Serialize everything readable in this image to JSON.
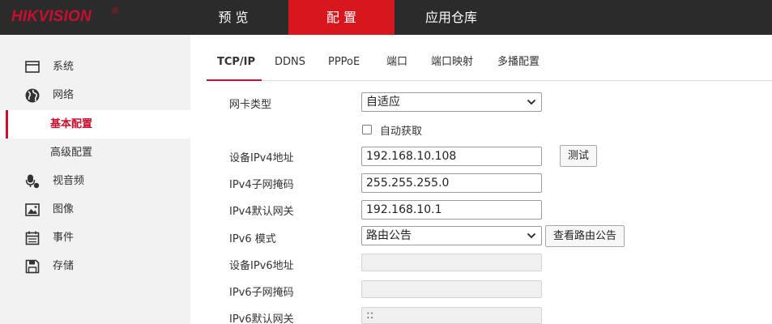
{
  "brand": {
    "logo_text": "HIKVISION",
    "reg_mark": "®",
    "accent": "#c8102e",
    "topbar_bg": "#2b2b2b",
    "active_nav_bg": "#d7161e"
  },
  "topnav": {
    "preview": "预 览",
    "config": "配 置",
    "apps": "应用仓库"
  },
  "sidebar": {
    "system": "系统",
    "network": "网络",
    "basic_config": "基本配置",
    "advanced_config": "高级配置",
    "video_audio": "视音频",
    "image": "图像",
    "event": "事件",
    "storage": "存储"
  },
  "tabs": [
    "TCP/IP",
    "DDNS",
    "PPPoE",
    "端口",
    "端口映射",
    "多播配置"
  ],
  "form": {
    "nic_type_label": "网卡类型",
    "nic_type_value": "自适应",
    "auto_obtain_label": "自动获取",
    "ipv4_addr_label": "设备IPv4地址",
    "ipv4_addr_value": "192.168.10.108",
    "test_button": "测试",
    "ipv4_mask_label": "IPv4子网掩码",
    "ipv4_mask_value": "255.255.255.0",
    "ipv4_gw_label": "IPv4默认网关",
    "ipv4_gw_value": "192.168.10.1",
    "ipv6_mode_label": "IPv6 模式",
    "ipv6_mode_value": "路由公告",
    "view_route_button": "查看路由公告",
    "ipv6_addr_label": "设备IPv6地址",
    "ipv6_addr_value": "",
    "ipv6_mask_label": "IPv6子网掩码",
    "ipv6_mask_value": "",
    "ipv6_gw_label": "IPv6默认网关",
    "ipv6_gw_value": "::"
  }
}
